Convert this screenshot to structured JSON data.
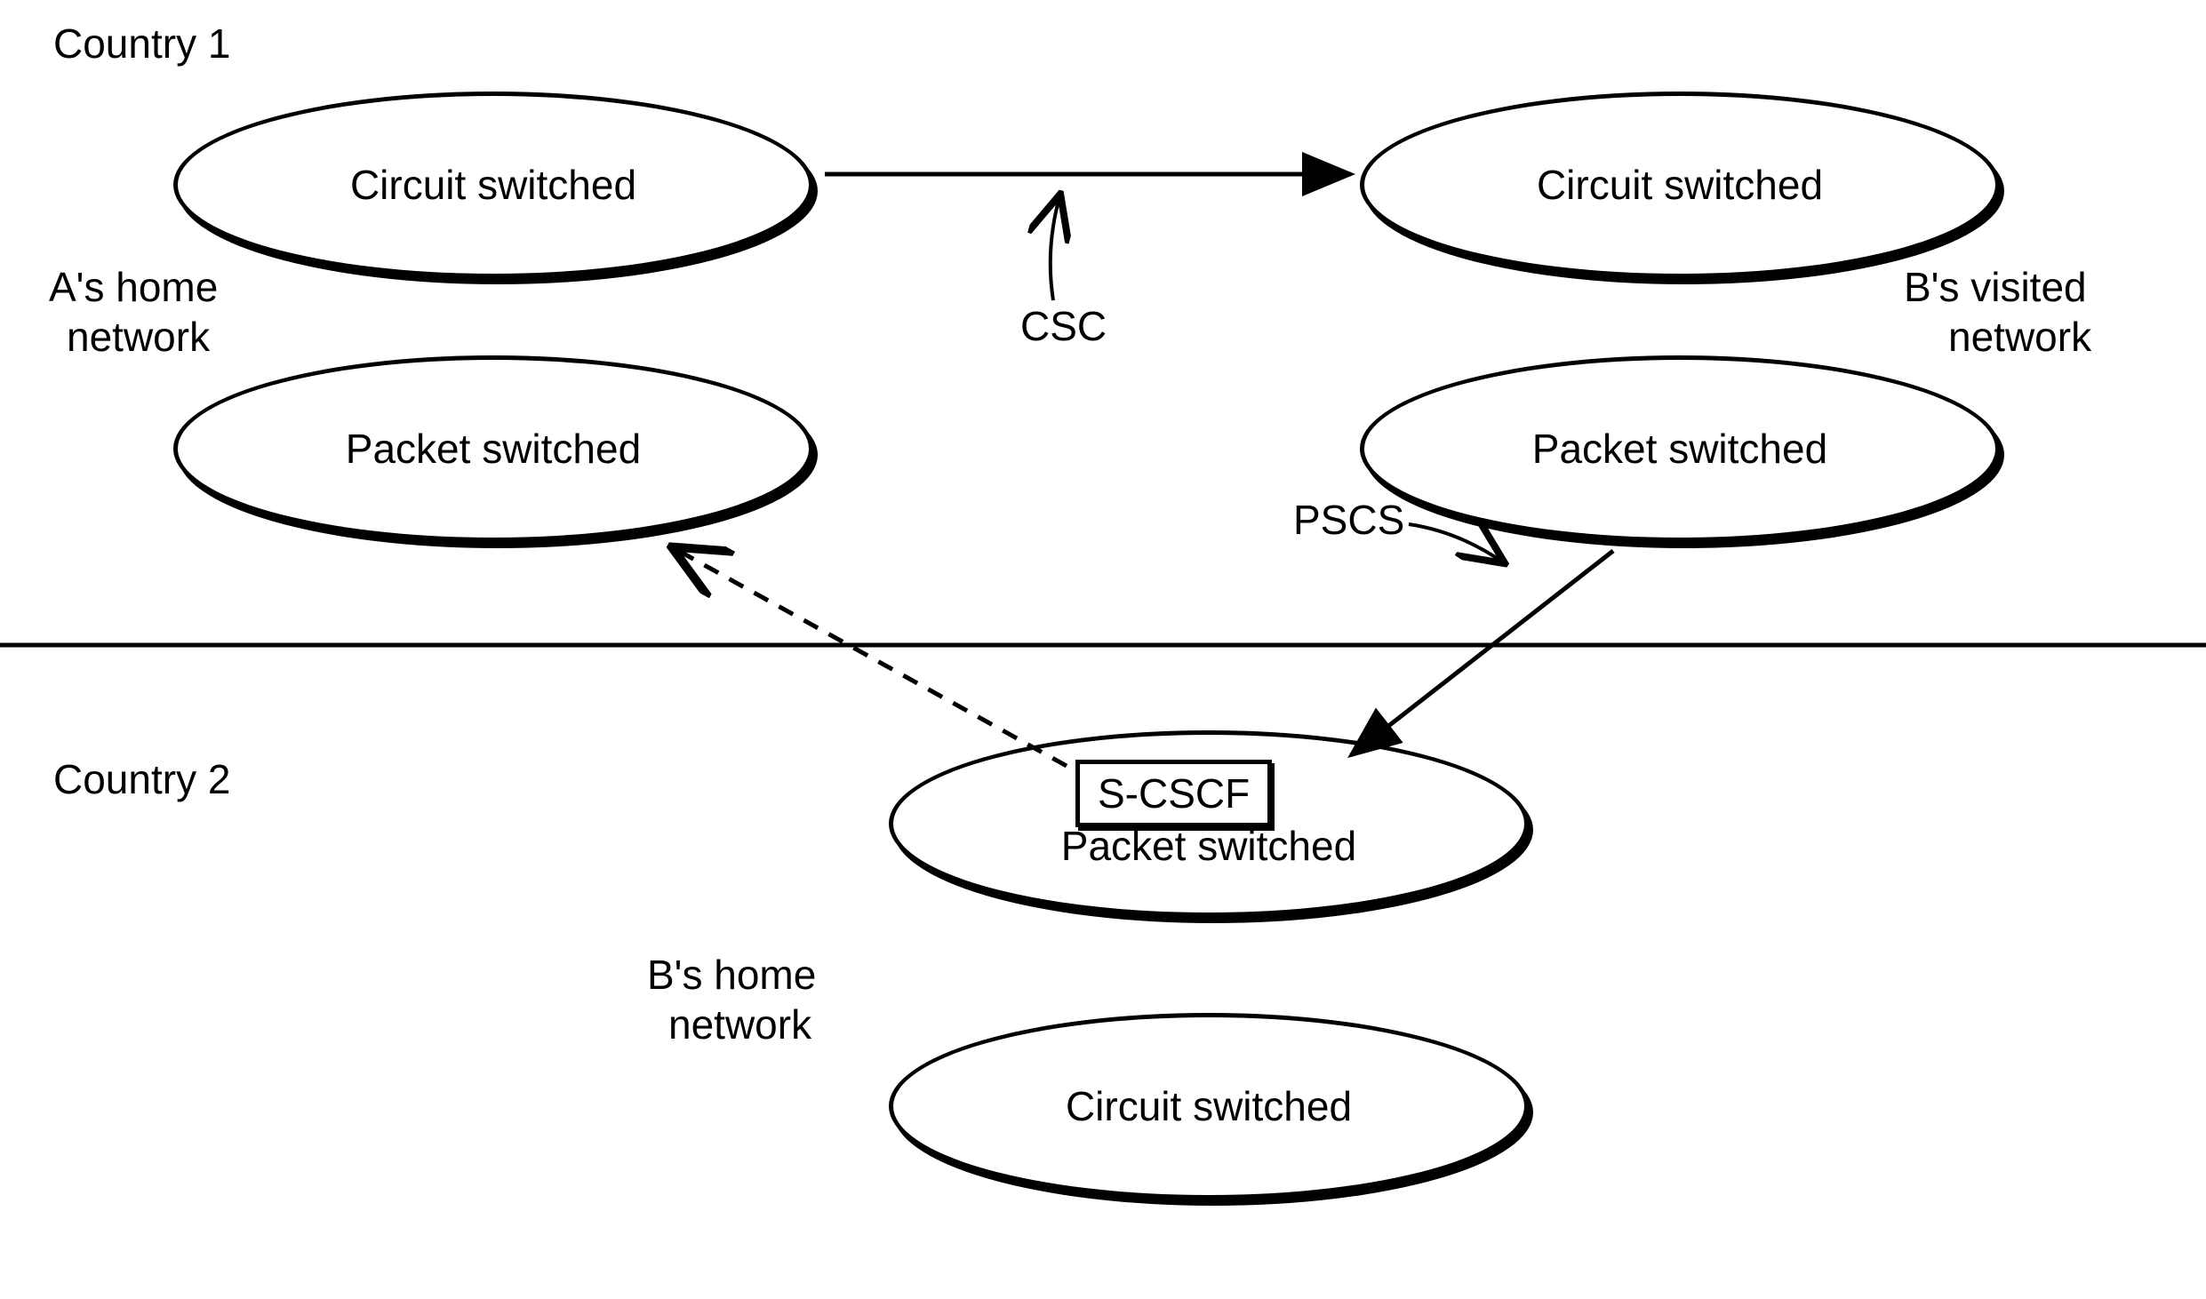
{
  "headings": {
    "country1": "Country 1",
    "country2": "Country 2"
  },
  "networks": {
    "a_home": {
      "label_line1": "A's home",
      "label_line2": "network"
    },
    "b_visited": {
      "label_line1": "B's visited",
      "label_line2": "network"
    },
    "b_home": {
      "label_line1": "B's home",
      "label_line2": "network"
    }
  },
  "nodes": {
    "a_cs": "Circuit switched",
    "a_ps": "Packet switched",
    "bv_cs": "Circuit switched",
    "bv_ps": "Packet switched",
    "bh_ps": "Packet switched",
    "bh_cs": "Circuit switched",
    "s_cscf": "S-CSCF"
  },
  "edges": {
    "csc": "CSC",
    "pscs": "PSCS"
  }
}
